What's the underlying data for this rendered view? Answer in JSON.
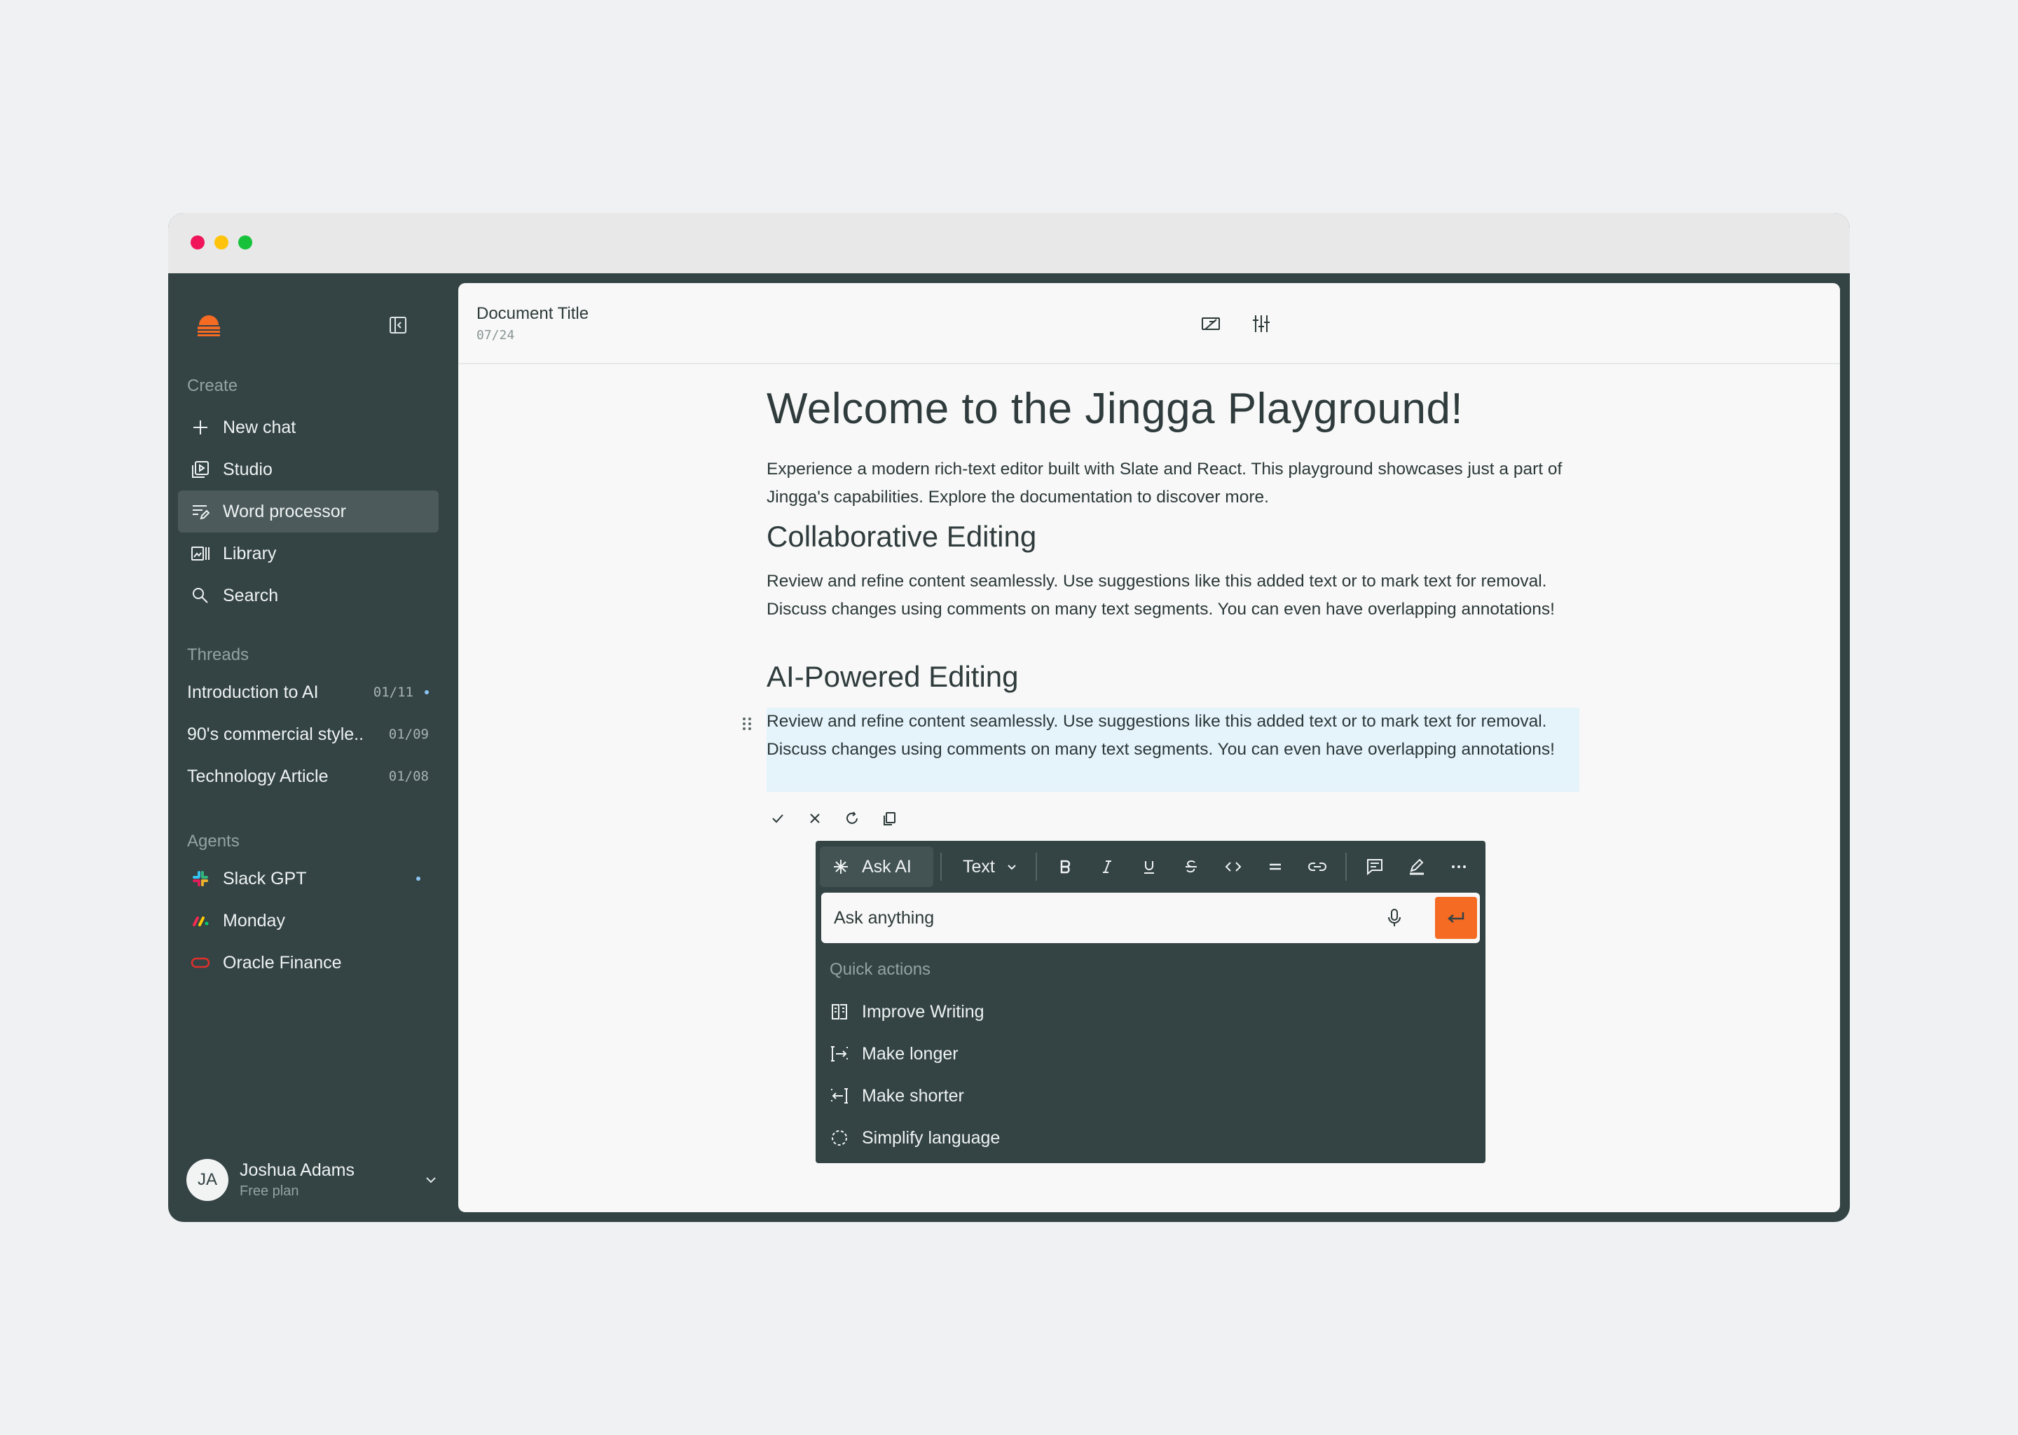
{
  "sidebar": {
    "create_label": "Create",
    "create_items": [
      {
        "label": "New chat",
        "icon": "plus-icon"
      },
      {
        "label": "Studio",
        "icon": "studio-icon"
      },
      {
        "label": "Word processor",
        "icon": "word-processor-icon",
        "active": true
      },
      {
        "label": "Library",
        "icon": "library-icon"
      },
      {
        "label": "Search",
        "icon": "search-icon"
      }
    ],
    "threads_label": "Threads",
    "threads": [
      {
        "title": "Introduction to AI",
        "date": "01/11",
        "unread": true
      },
      {
        "title": "90's commercial style..",
        "date": "01/09"
      },
      {
        "title": "Technology Article",
        "date": "01/08"
      }
    ],
    "agents_label": "Agents",
    "agents": [
      {
        "label": "Slack GPT",
        "icon": "slack-icon",
        "unread": true
      },
      {
        "label": "Monday",
        "icon": "monday-icon"
      },
      {
        "label": "Oracle Finance",
        "icon": "oracle-icon"
      }
    ],
    "user": {
      "initials": "JA",
      "name": "Joshua Adams",
      "plan": "Free plan"
    }
  },
  "document": {
    "title": "Document Title",
    "date": "07/24",
    "heading": "Welcome to the Jingga Playground!",
    "intro": "Experience a modern rich-text editor built with  Slate and React. This playground showcases just a part of Jingga's capabilities.  Explore the documentation  to discover more.",
    "section1_heading": "Collaborative Editing",
    "section1_body": "Review and refine content seamlessly. Use  suggestions  like this added text or to mark text for removal. Discuss changes using  comments  on many text segments. You can even have overlapping annotations!",
    "section2_heading": "AI-Powered Editing",
    "section2_body": "Review and refine content seamlessly. Use  suggestions  like this added text or to mark text for removal. Discuss changes using  comments  on many text segments. You can even have overlapping annotations!"
  },
  "ai_menu": {
    "ask_ai_label": "Ask AI",
    "block_type": "Text",
    "input_value": "Ask anything",
    "quick_actions_label": "Quick actions",
    "quick_actions": [
      {
        "label": "Improve Writing",
        "icon": "improve-writing-icon"
      },
      {
        "label": "Make longer",
        "icon": "make-longer-icon"
      },
      {
        "label": "Make shorter",
        "icon": "make-shorter-icon"
      },
      {
        "label": "Simplify language",
        "icon": "simplify-language-icon"
      }
    ]
  },
  "colors": {
    "sidebar_bg": "#344344",
    "accent": "#f56b24",
    "selection_bg": "#e5f3fb"
  }
}
